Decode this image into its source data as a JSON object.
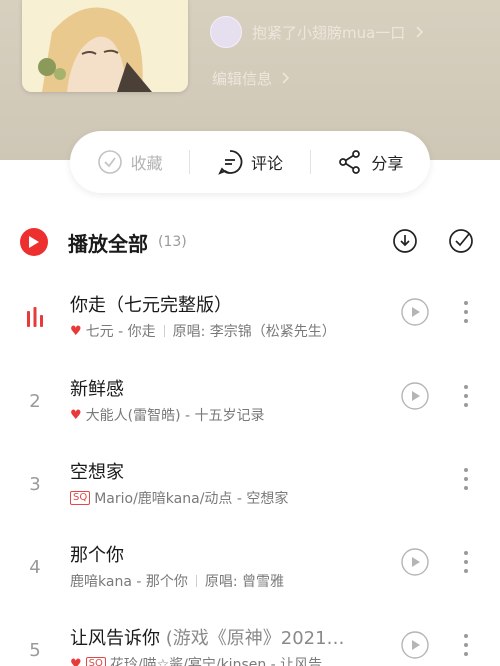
{
  "header": {
    "creator_name": "抱紧了小翅膀mua一口",
    "edit_info": "编辑信息"
  },
  "actions": {
    "favorite": "收藏",
    "comment": "评论",
    "share": "分享"
  },
  "playlist": {
    "play_all": "播放全部",
    "count": "(13)"
  },
  "songs": [
    {
      "index": "",
      "playing": true,
      "title": "你走（七元完整版）",
      "title_extra": "",
      "heart": true,
      "sq": false,
      "artist_album": "七元 - 你走",
      "original": "原唱: 李宗锦（松紧先生）"
    },
    {
      "index": "2",
      "playing": false,
      "title": "新鲜感",
      "title_extra": "",
      "heart": true,
      "sq": false,
      "artist_album": "大能人(雷智皓) - 十五岁记录",
      "original": ""
    },
    {
      "index": "3",
      "playing": false,
      "title": "空想家",
      "title_extra": "",
      "heart": false,
      "sq": true,
      "artist_album": "Mario/鹿喑kana/动点 - 空想家",
      "original": ""
    },
    {
      "index": "4",
      "playing": false,
      "title": "那个你",
      "title_extra": "",
      "heart": false,
      "sq": false,
      "artist_album": "鹿喑kana - 那个你",
      "original": "原唱: 曾雪雅"
    },
    {
      "index": "5",
      "playing": false,
      "title": "让风告诉你",
      "title_extra": " (游戏《原神》2021…",
      "heart": true,
      "sq": true,
      "artist_album": "花玲/喵☆酱/宴宁/kinsen - 让风告",
      "original": ""
    }
  ]
}
